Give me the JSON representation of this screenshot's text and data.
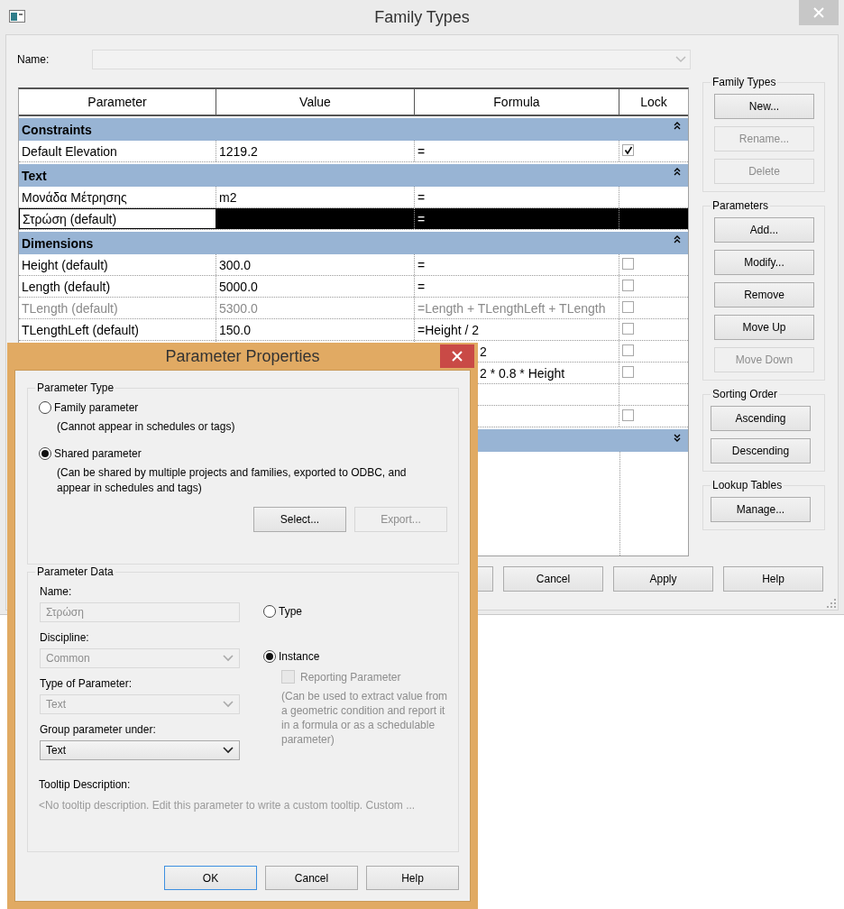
{
  "window": {
    "title": "Family Types"
  },
  "name_field": {
    "label": "Name:"
  },
  "table": {
    "columns": [
      "Parameter",
      "Value",
      "Formula",
      "Lock"
    ],
    "groups": [
      {
        "name": "Constraints",
        "expanded": true,
        "rows": [
          {
            "parameter": "Default Elevation",
            "value": "1219.2",
            "formula": "=",
            "lock": true,
            "selected": false,
            "disabled": false
          }
        ]
      },
      {
        "name": "Text",
        "expanded": true,
        "rows": [
          {
            "parameter": "Μονάδα Μέτρησης",
            "value": "m2",
            "formula": "=",
            "selected": false,
            "disabled": false
          },
          {
            "parameter": "Στρώση (default)",
            "formula": "=",
            "selected": true,
            "disabled": false
          }
        ]
      },
      {
        "name": "Dimensions",
        "expanded": true,
        "rows": [
          {
            "parameter": "Height (default)",
            "value": "300.0",
            "formula": "=",
            "lock": false,
            "selected": false,
            "disabled": false
          },
          {
            "parameter": "Length (default)",
            "value": "5000.0",
            "formula": "=",
            "lock": false,
            "selected": false,
            "disabled": false
          },
          {
            "parameter": "TLength (default)",
            "value": "5300.0",
            "formula": "=Length + TLengthLeft + TLength",
            "lock": false,
            "selected": false,
            "disabled": true
          },
          {
            "parameter": "TLengthLeft (default)",
            "value": "150.0",
            "formula": "=Height / 2",
            "lock": false,
            "selected": false,
            "disabled": false
          },
          {
            "formula": "2",
            "formula_clipped": true,
            "lock": false,
            "selected": false,
            "disabled": false
          },
          {
            "formula": "2 * 0.8 * Height",
            "formula_clipped": true,
            "lock": false,
            "selected": false,
            "disabled": false
          },
          {
            "selected": false
          },
          {
            "lock": false,
            "selected": false
          }
        ]
      },
      {
        "expanded": false
      }
    ]
  },
  "side_groups": [
    {
      "title": "Family Types",
      "buttons": [
        {
          "label": "New...",
          "disabled": false
        },
        {
          "label": "Rename...",
          "disabled": true
        },
        {
          "label": "Delete",
          "disabled": true
        }
      ]
    },
    {
      "title": "Parameters",
      "buttons": [
        {
          "label": "Add...",
          "disabled": false
        },
        {
          "label": "Modify...",
          "disabled": false
        },
        {
          "label": "Remove",
          "disabled": false
        },
        {
          "label": "Move Up",
          "disabled": false
        },
        {
          "label": "Move Down",
          "disabled": true
        }
      ]
    },
    {
      "title": "Sorting Order",
      "buttons": [
        {
          "label": "Ascending",
          "disabled": false
        },
        {
          "label": "Descending",
          "disabled": false
        }
      ]
    },
    {
      "title": "Lookup Tables",
      "buttons": [
        {
          "label": "Manage...",
          "disabled": false
        }
      ]
    }
  ],
  "bottom_buttons": [
    "Cancel",
    "Apply",
    "Help"
  ],
  "dialog": {
    "title": "Parameter Properties",
    "parameter_type": {
      "title": "Parameter Type",
      "options": [
        {
          "label": "Family parameter",
          "note": "(Cannot appear in schedules or tags)",
          "selected": false
        },
        {
          "label": "Shared parameter",
          "note": "(Can be shared by multiple projects and families, exported to ODBC, and appear in schedules and tags)",
          "selected": true
        }
      ],
      "buttons": [
        {
          "label": "Select...",
          "disabled": false
        },
        {
          "label": "Export...",
          "disabled": true
        }
      ]
    },
    "parameter_data": {
      "title": "Parameter Data",
      "fields": [
        {
          "label": "Name:",
          "value": "Στρώση",
          "kind": "text",
          "disabled": true
        },
        {
          "label": "Discipline:",
          "value": "Common",
          "kind": "select",
          "disabled": true
        },
        {
          "label": "Type of Parameter:",
          "value": "Text",
          "kind": "select",
          "disabled": true
        },
        {
          "label": "Group parameter under:",
          "value": "Text",
          "kind": "select",
          "disabled": false
        }
      ],
      "scope": [
        {
          "label": "Type",
          "selected": false
        },
        {
          "label": "Instance",
          "selected": true
        }
      ],
      "reporting": {
        "label": "Reporting Parameter",
        "checked": false,
        "disabled": true,
        "note": "(Can be used to extract value from a geometric condition and report it in a formula or as a schedulable parameter)"
      },
      "tooltip": {
        "label": "Tooltip Description:",
        "text": "<No tooltip description. Edit this parameter to write a custom tooltip. Custom ..."
      }
    },
    "buttons": [
      {
        "label": "OK",
        "default": true
      },
      {
        "label": "Cancel",
        "default": false
      },
      {
        "label": "Help",
        "default": false
      }
    ]
  }
}
